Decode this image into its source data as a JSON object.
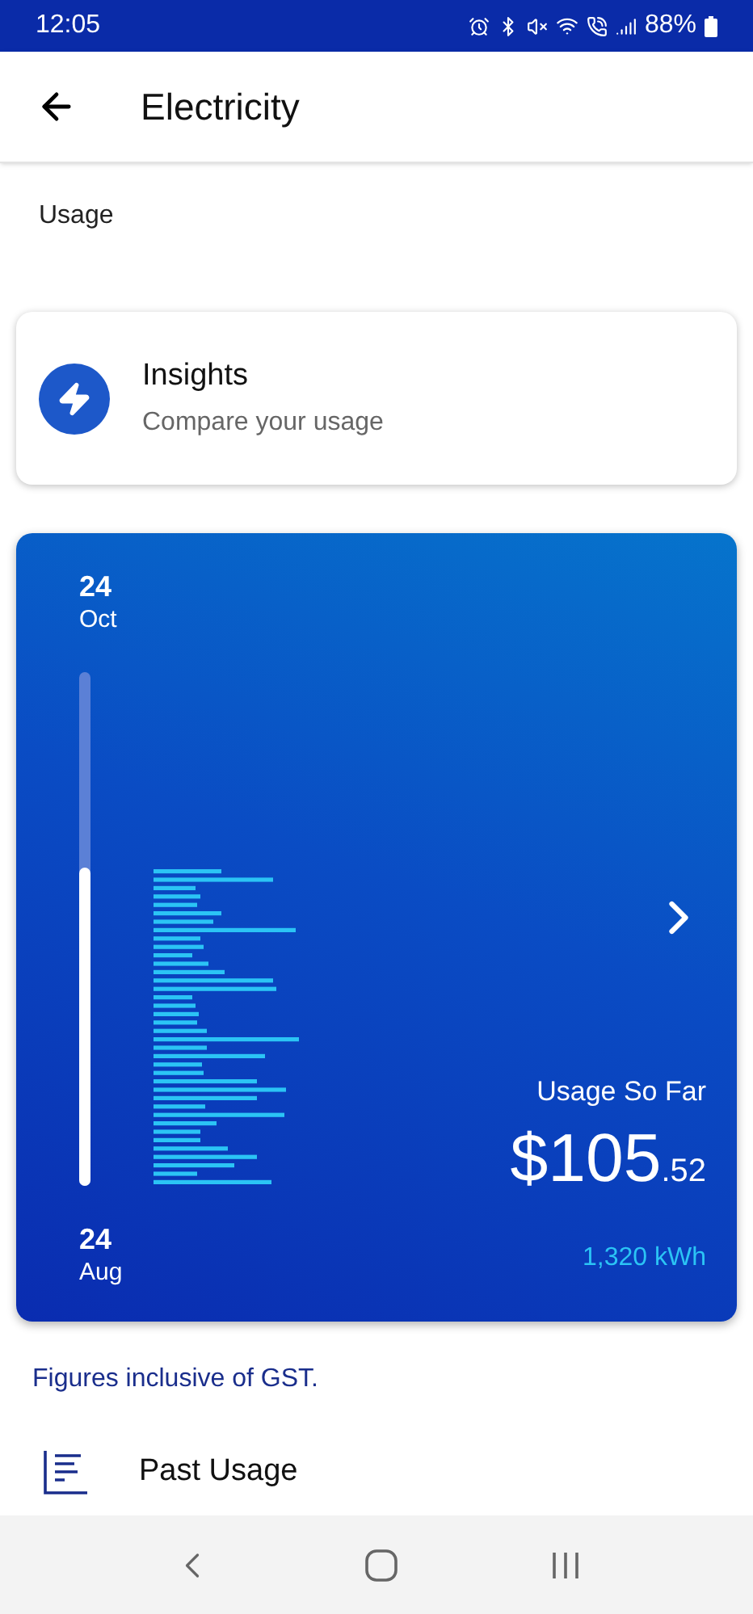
{
  "status_bar": {
    "time": "12:05",
    "battery": "88%"
  },
  "header": {
    "title": "Electricity"
  },
  "section_label": "Usage",
  "insights": {
    "title": "Insights",
    "subtitle": "Compare your usage"
  },
  "usage_card": {
    "end_day": "24",
    "end_month": "Oct",
    "start_day": "24",
    "start_month": "Aug",
    "level": 0.62,
    "label": "Usage So Far",
    "amount_main": "$105",
    "amount_cents": ".52",
    "energy": "1,320 kWh"
  },
  "note": "Figures inclusive of GST.",
  "past_usage": {
    "label": "Past Usage"
  }
}
